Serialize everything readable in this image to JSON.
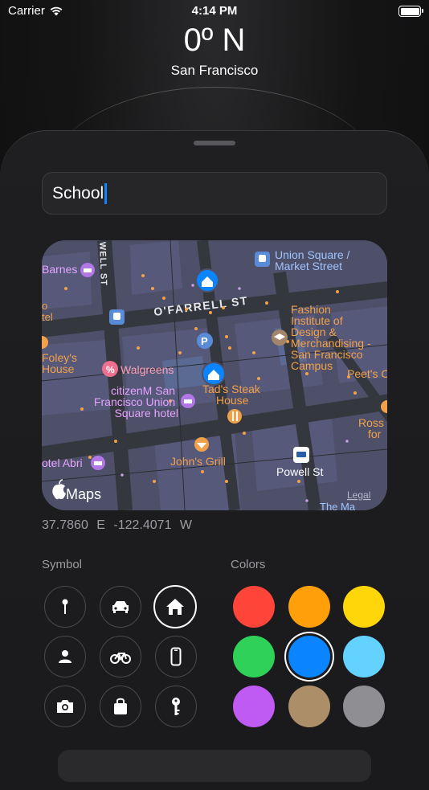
{
  "status_bar": {
    "carrier": "Carrier",
    "time": "4:14 PM"
  },
  "header": {
    "heading": "0º N",
    "city": "San Francisco"
  },
  "name_field": {
    "value": "School"
  },
  "map": {
    "streets": [
      "WELL ST",
      "O'FARRELL ST"
    ],
    "labels": {
      "union_square": "Union Square / Market Street",
      "fashion_institute": "Fashion Institute of Design & Merchandising - San Francisco Campus",
      "barnes": "Barnes",
      "foleys": "Foley's House",
      "walgreens": "Walgreens",
      "tads": "Tad's Steak House",
      "citizenm": "citizenM San Francisco Union Square hotel",
      "peets": "Peet's C",
      "ross": "Ross for",
      "johns": "John's Grill",
      "powell": "Powell St",
      "hotel_abri": "otel Abri",
      "left_edge": "o tel",
      "apple_maps": "Maps",
      "legal": "Legal",
      "bottom_partial": "The Ma"
    }
  },
  "coordinates": "37.7860 E -122.4071 W",
  "symbols": {
    "label": "Symbol",
    "items": [
      "pin-icon",
      "car-icon",
      "house-icon",
      "person-icon",
      "bicycle-icon",
      "phone-icon",
      "camera-icon",
      "bag-icon",
      "key-icon"
    ],
    "selected": "house-icon"
  },
  "colors": {
    "label": "Colors",
    "items": [
      "#ff453a",
      "#ff9f0a",
      "#ffd60a",
      "#30d158",
      "#0a84ff",
      "#64d2ff",
      "#bf5af2",
      "#ac8e68",
      "#8e8e93"
    ],
    "selected": "#0a84ff"
  }
}
